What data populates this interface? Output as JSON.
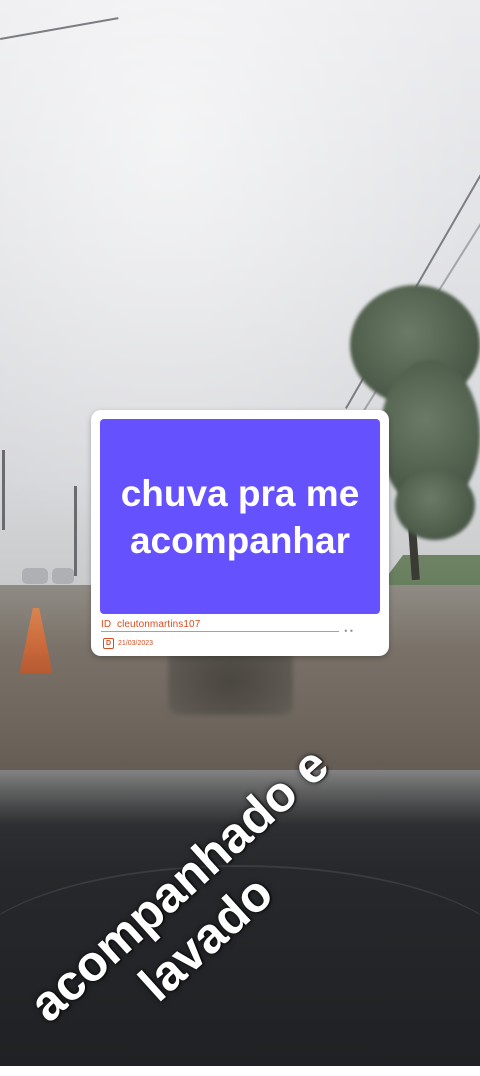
{
  "sticker": {
    "title": "chuva pra me acompanhar",
    "id_prefix": "ID",
    "username": "cleutonmartins107",
    "date": "21/03/2023",
    "date_icon": "D",
    "accent_color": "#6651ff",
    "meta_color": "#d94c1f"
  },
  "overlay": {
    "line1": "acompanhado e",
    "line2": "lavado",
    "color": "#ffffff"
  }
}
